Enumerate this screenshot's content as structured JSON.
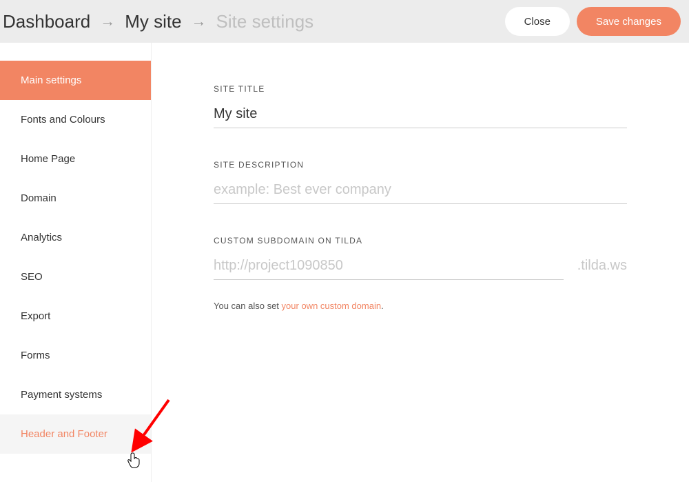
{
  "breadcrumb": {
    "dashboard": "Dashboard",
    "site": "My site",
    "settings": "Site settings"
  },
  "buttons": {
    "close": "Close",
    "save": "Save changes"
  },
  "sidebar": {
    "items": [
      {
        "label": "Main settings",
        "active": true,
        "hover": false
      },
      {
        "label": "Fonts and Colours",
        "active": false,
        "hover": false
      },
      {
        "label": "Home Page",
        "active": false,
        "hover": false
      },
      {
        "label": "Domain",
        "active": false,
        "hover": false
      },
      {
        "label": "Analytics",
        "active": false,
        "hover": false
      },
      {
        "label": "SEO",
        "active": false,
        "hover": false
      },
      {
        "label": "Export",
        "active": false,
        "hover": false
      },
      {
        "label": "Forms",
        "active": false,
        "hover": false
      },
      {
        "label": "Payment systems",
        "active": false,
        "hover": false
      },
      {
        "label": "Header and Footer",
        "active": false,
        "hover": true
      }
    ]
  },
  "form": {
    "site_title_label": "SITE TITLE",
    "site_title_value": "My site",
    "site_description_label": "SITE DESCRIPTION",
    "site_description_placeholder": "example: Best ever company",
    "subdomain_label": "CUSTOM SUBDOMAIN ON TILDA",
    "subdomain_prefix": "http://",
    "subdomain_value": "project1090850",
    "subdomain_suffix": ".tilda.ws",
    "helper_text": "You can also set ",
    "helper_link": "your own custom domain",
    "helper_period": "."
  }
}
